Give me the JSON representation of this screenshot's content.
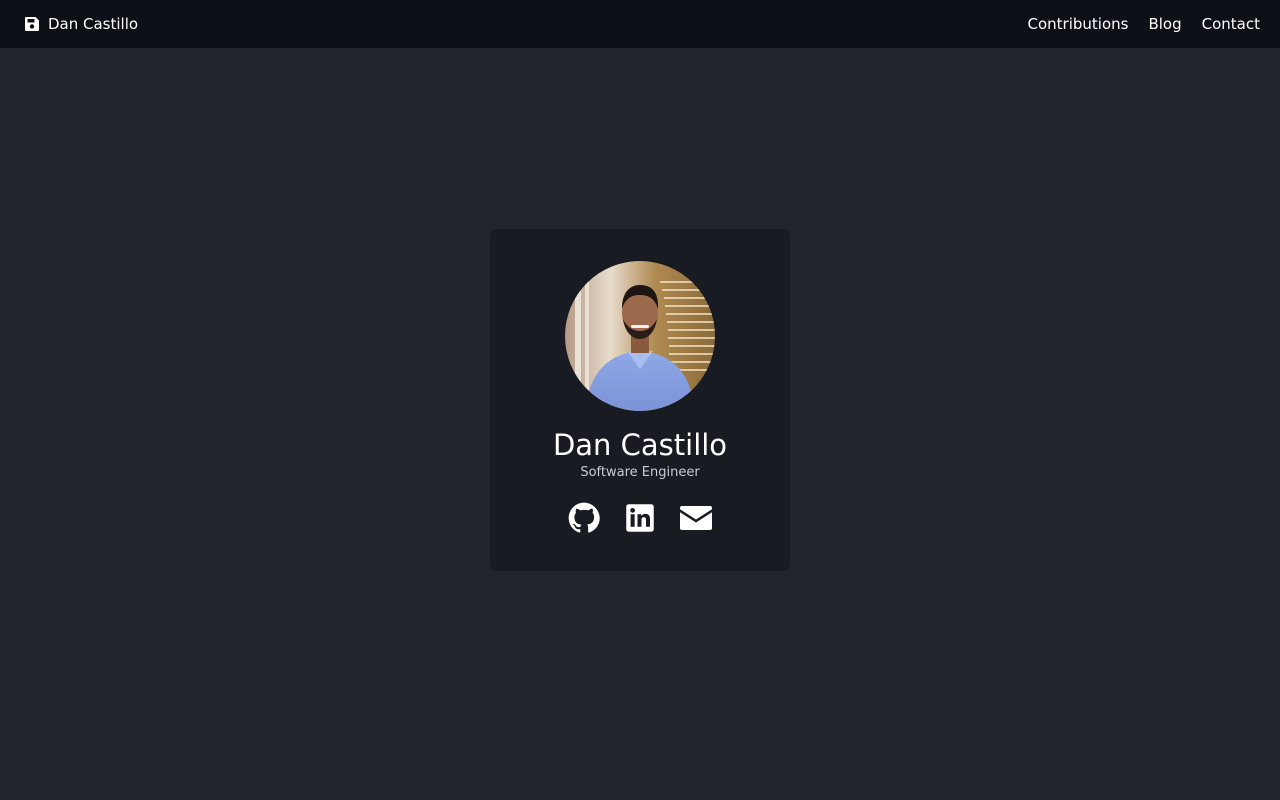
{
  "navbar": {
    "brand": {
      "label": "Dan Castillo",
      "icon": "floppy-disk-icon"
    },
    "links": [
      {
        "label": "Contributions"
      },
      {
        "label": "Blog"
      },
      {
        "label": "Contact"
      }
    ]
  },
  "profile": {
    "name": "Dan Castillo",
    "title": "Software Engineer",
    "avatar_icon": "profile-photo",
    "socials": [
      {
        "icon": "github-icon"
      },
      {
        "icon": "linkedin-icon"
      },
      {
        "icon": "envelope-icon"
      }
    ]
  },
  "colors": {
    "page_background": "#20242c",
    "navbar_background": "#0d1017",
    "card_background": "#181b22",
    "text": "#ffffff",
    "muted_text": "#c8ccd4"
  }
}
